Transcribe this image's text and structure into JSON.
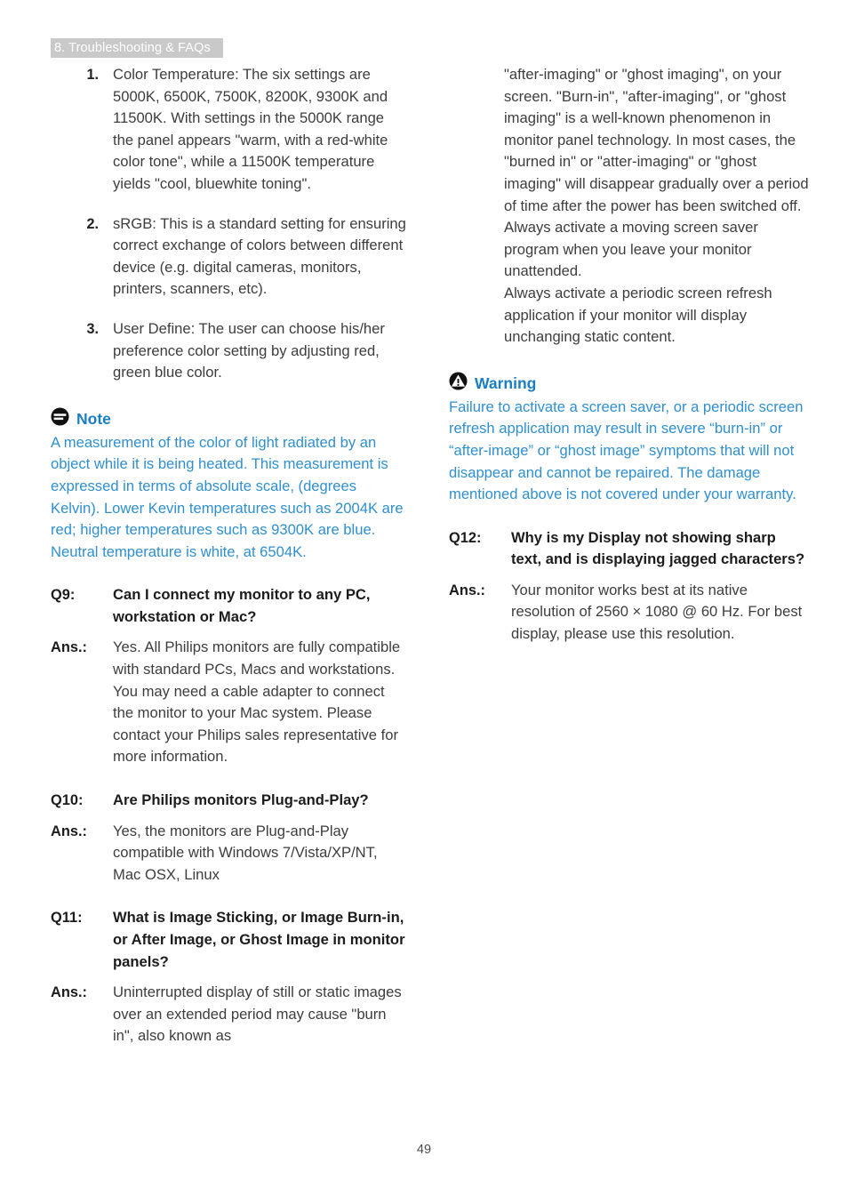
{
  "header": {
    "section_label": "8. Troubleshooting & FAQs",
    "badge_color": "#c9c9c9",
    "badge_text_color": "#ffffff"
  },
  "colors": {
    "note_title": "#1a7ec4",
    "note_body": "#2f8fd0",
    "body_text": "#3d3d3d"
  },
  "left_column": {
    "numbered_list": [
      {
        "number": "1.",
        "text": "Color Temperature: The six settings are 5000K, 6500K, 7500K, 8200K, 9300K and 11500K. With settings in the 5000K range the panel appears \"warm, with a red-white color tone\", while a 11500K temperature yields \"cool, bluewhite toning\"."
      },
      {
        "number": "2.",
        "text": "sRGB: This is a standard setting for ensuring correct exchange of colors between different device (e.g. digital cameras, monitors, printers, scanners, etc)."
      },
      {
        "number": "3.",
        "text": "User Define: The user can choose his/her preference color setting by adjusting red, green blue color."
      }
    ],
    "note": {
      "icon": "note-icon",
      "title": "Note",
      "body": "A measurement of the color of light radiated by an object while it is being heated. This measurement is expressed in terms of absolute scale, (degrees Kelvin). Lower Kevin temperatures such as 2004K are red; higher temperatures such as 9300K are blue. Neutral temperature is white, at 6504K."
    },
    "faqs": [
      {
        "q_label": "Q9:",
        "question": "Can I connect my monitor to any PC, workstation or Mac?",
        "a_label": "Ans.:",
        "answer": "Yes. All Philips monitors are fully compatible with standard PCs, Macs and workstations. You may need a cable adapter to connect the monitor to your Mac system. Please contact your Philips sales representative for more information."
      },
      {
        "q_label": "Q10:",
        "question": "Are Philips monitors Plug-and-Play?",
        "a_label": "Ans.:",
        "answer": "Yes, the monitors are Plug-and-Play compatible with Windows 7/Vista/XP/NT, Mac OSX, Linux"
      },
      {
        "q_label": "Q11:",
        "question": "What is Image Sticking, or Image Burn-in, or After Image, or Ghost Image in monitor panels?",
        "a_label": "Ans.:",
        "answer": "Uninterrupted display of still or static images over an extended period may cause \"burn in\", also known as"
      }
    ]
  },
  "right_column": {
    "continuation": [
      "\"after-imaging\" or \"ghost imaging\", on your screen. \"Burn-in\", \"after-imaging\", or \"ghost imaging\" is a well-known phenomenon in monitor panel technology. In most cases, the \"burned in\" or \"atter-imaging\" or \"ghost imaging\" will disappear gradually over a period of time after the power has been switched off.",
      "Always activate a moving screen saver program when you leave your monitor unattended.",
      "Always activate a periodic screen refresh application if your monitor will display unchanging static content."
    ],
    "warning": {
      "icon": "warning-icon",
      "title": "Warning",
      "body": "Failure to activate a screen saver, or a periodic screen refresh application may result in severe “burn-in” or “after-image” or “ghost image” symptoms that will not disappear and cannot be repaired. The damage mentioned above is not covered under your warranty."
    },
    "faqs": [
      {
        "q_label": "Q12:",
        "question": "Why is my Display not showing sharp text, and is displaying jagged characters?",
        "a_label": "Ans.:",
        "answer": "Your monitor works best at its native resolution of 2560 × 1080 @ 60 Hz. For best display, please use this resolution."
      }
    ]
  },
  "footer": {
    "page_number": "49"
  }
}
